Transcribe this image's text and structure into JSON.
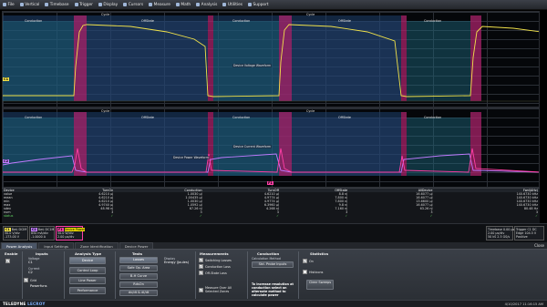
{
  "menu": [
    {
      "label": "File",
      "icon": "file-icon"
    },
    {
      "label": "Vertical",
      "icon": "vertical-icon"
    },
    {
      "label": "Timebase",
      "icon": "timebase-icon"
    },
    {
      "label": "Trigger",
      "icon": "trigger-icon"
    },
    {
      "label": "Display",
      "icon": "display-icon"
    },
    {
      "label": "Cursors",
      "icon": "cursors-icon"
    },
    {
      "label": "Measure",
      "icon": "measure-icon"
    },
    {
      "label": "Math",
      "icon": "math-icon"
    },
    {
      "label": "Analysis",
      "icon": "analysis-icon"
    },
    {
      "label": "Utilities",
      "icon": "utilities-icon"
    },
    {
      "label": "Support",
      "icon": "support-icon"
    }
  ],
  "zones": {
    "cycle": "Cycle",
    "conduction": "Conduction",
    "offstate": "OffState"
  },
  "annotations": {
    "device_voltage": "Device Voltage Waveform",
    "device_current": "Device Current Waveform",
    "device_power": "Device Power Waveform"
  },
  "channel_marks": {
    "c1": "C1",
    "c2": "C2",
    "f1": "F1"
  },
  "measurements": {
    "header": [
      "Device",
      "TurnOn",
      "Conduction",
      "TurnOff",
      "OffState",
      "AllDevice",
      "Fwd(AHz)"
    ],
    "rows": [
      [
        "value",
        "4.6210 μJ",
        "1.0030 μJ",
        "4.6210 μJ",
        "8.8 nJ",
        "16.6077 μJ",
        "140.6730 kHz"
      ],
      [
        "mean",
        "4.6210 μJ",
        "1.00435 μJ",
        "4.9774 μJ",
        "7.800 nJ",
        "16.6077 μJ",
        "140.6730 kHz"
      ],
      [
        "min",
        "4.6210 μJ",
        "1.0030 μJ",
        "4.9774 μJ",
        "7.800 nJ",
        "13.6600 μJ",
        "140.6730 kHz"
      ],
      [
        "max",
        "4.9740 μJ",
        "1.0592 μJ",
        "6.3960 μJ",
        "9.8 nJ",
        "16.6077 μJ",
        "140.6730 kHz"
      ],
      [
        "sdev",
        "48.98 nJ",
        "67.26 nJ",
        "4.268 nJ",
        "7.160 nJ",
        "63.26 nJ",
        "80.48 Hz"
      ],
      [
        "num",
        "3",
        "3",
        "3",
        "3",
        "3",
        "3"
      ]
    ],
    "status": [
      "status",
      "✓",
      "✓",
      "✓",
      "✓",
      "✓",
      "✓"
    ]
  },
  "descriptors": {
    "c1": {
      "tag": "C1",
      "l1": "BwL DCIM",
      "l2": "50.0 V/div",
      "l3": "-173.00 V"
    },
    "c2": {
      "tag": "C2",
      "l1": "BwL DC1M",
      "l2": "850 mA/div",
      "l3": "-1.0000 A"
    },
    "f1": {
      "tag": "F1",
      "l1": "Device Power",
      "l2": "50.0 W/div",
      "l3": "2.00 μs/div"
    },
    "timebase": {
      "title": "Timebase",
      "l1": "0.00 μs",
      "l2": "2.00 μs/div",
      "l3": "50 kS  2.5 GS/s"
    },
    "trigger": {
      "title": "Trigger",
      "l1": "C1 DC",
      "l2": "Edge",
      "l3": "Positive",
      "level": "104.5 V"
    }
  },
  "tabs": [
    "Power Analysis",
    "Input Settings",
    "Zone Identification",
    "Device Power"
  ],
  "close_label": "Close",
  "dialog": {
    "enable_title": "Enable",
    "inputs": {
      "title": "Inputs",
      "voltage_label": "Voltage",
      "voltage_value": "C1",
      "current_label": "Current",
      "current_value": "C2",
      "grid_label": "Grid",
      "grid_value": "Powerfuns"
    },
    "analysis_type": {
      "title": "Analysis Type",
      "buttons": [
        "Device",
        "Control Loop",
        "Line Power",
        "Performance"
      ],
      "selected": "Device"
    },
    "tests": {
      "title": "Tests",
      "buttons": [
        "Losses",
        "Safe Op. Area",
        "B-H Curve",
        "RdsOn",
        "dv/dt & di/dt"
      ],
      "selected": "Losses"
    },
    "display": {
      "label": "Display",
      "value": "Energy (Joules)"
    },
    "measurements": {
      "title": "Measurements",
      "items": [
        "Switching Losses",
        "Conduction Loss",
        "Off-State Loss"
      ],
      "extra": "Measure Over All Selected Zones"
    },
    "conduction": {
      "title": "Conduction",
      "method_label": "Calculation Method",
      "method_value": "Std. Probe Inputs",
      "note": "To increase resolution at conduction select an alternate method to calculate power"
    },
    "statistics": {
      "title": "Statistics",
      "on_label": "On",
      "histicons_label": "Histicons",
      "clear_label": "Clear Sweeps"
    }
  },
  "logo": {
    "brand": "TELEDYNE",
    "sub": "LECROY"
  },
  "datetime": "4/10/2017 11:16:15 AM",
  "colors": {
    "voltage": "#f2e34a",
    "current": "#c07bff",
    "power": "#ff3fa6",
    "zone_cycle": "#3b6fb3",
    "zone_conduction": "#2e7a9a",
    "zone_turn": "#c0287a"
  }
}
